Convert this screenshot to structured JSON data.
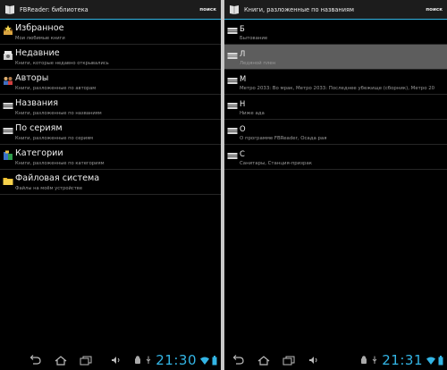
{
  "left": {
    "title": "FBReader: библиотека",
    "search_label": "поиск",
    "items": [
      {
        "title": "Избранное",
        "subtitle": "Мои любимые книги",
        "icon": "favorites-icon"
      },
      {
        "title": "Недавние",
        "subtitle": "Книги, которые недавно открывались",
        "icon": "recent-icon"
      },
      {
        "title": "Авторы",
        "subtitle": "Книги, разложенные по авторам",
        "icon": "authors-icon"
      },
      {
        "title": "Названия",
        "subtitle": "Книги, разложенные по названиям",
        "icon": "titles-icon"
      },
      {
        "title": "По сериям",
        "subtitle": "Книги, разложенные по сериям",
        "icon": "series-icon"
      },
      {
        "title": "Категории",
        "subtitle": "Книги, разложенные по категориям",
        "icon": "categories-icon"
      },
      {
        "title": "Файловая система",
        "subtitle": "Файлы на моём устройстве",
        "icon": "folder-icon"
      }
    ],
    "clock": "21:30"
  },
  "right": {
    "title": "Книги, разложенные по названиям",
    "search_label": "поиск",
    "items": [
      {
        "title": "Б",
        "subtitle": "Бытование"
      },
      {
        "title": "Л",
        "subtitle": "Ледяной плен"
      },
      {
        "title": "М",
        "subtitle": "Метро 2033: Во мрак,  Метро 2033: Последнее убежище (сборник),  Метро 20"
      },
      {
        "title": "Н",
        "subtitle": "Ниже ада"
      },
      {
        "title": "О",
        "subtitle": "О программе FBReader,  Осада рая"
      },
      {
        "title": "С",
        "subtitle": "Санитары,  Станция-призрак"
      }
    ],
    "clock": "21:31",
    "selected_index": 1
  },
  "colors": {
    "accent": "#33b5e5",
    "selected_row": "#5d5d5d",
    "background": "#000000"
  }
}
